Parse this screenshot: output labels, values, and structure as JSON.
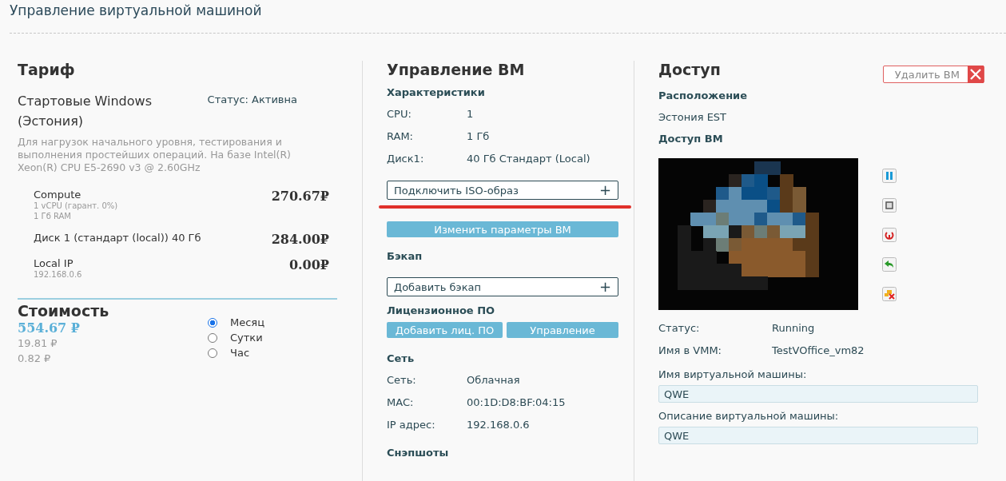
{
  "page_title": "Управление виртуальной машиной",
  "tariff": {
    "heading": "Тариф",
    "name": "Стартовые Windows (Эстония)",
    "status": "Статус: Активна",
    "description": "Для нагрузок начального уровня, тестирования и выполнения простейших операций. На базе Intel(R) Xeon(R) CPU E5-2690 v3 @ 2.60GHz",
    "items": [
      {
        "name": "Compute",
        "details": [
          "1 vCPU (гарант. 0%)",
          "1 Гб RAM"
        ],
        "price": "270.67₽"
      },
      {
        "name": "Диск 1 (стандарт (local)) 40 Гб",
        "price": "284.00₽"
      },
      {
        "name": "Local IP",
        "details": [
          "192.168.0.6"
        ],
        "price": "0.00₽"
      }
    ]
  },
  "cost": {
    "heading": "Стоимость",
    "amounts": [
      "554.67 ₽",
      "19.81 ₽",
      "0.82 ₽"
    ],
    "periods": [
      {
        "label": "Месяц",
        "selected": true
      },
      {
        "label": "Сутки",
        "selected": false
      },
      {
        "label": "Час",
        "selected": false
      }
    ]
  },
  "vm": {
    "heading": "Управление ВМ",
    "specs_heading": "Характеристики",
    "specs": [
      {
        "label": "CPU:",
        "value": "1"
      },
      {
        "label": "RAM:",
        "value": "1 Гб"
      },
      {
        "label": "Диск1:",
        "value": "40 Гб Стандарт (Local)"
      }
    ],
    "iso_button": "Подключить ISO-образ",
    "iso_plus": "+",
    "change_button": "Изменить параметры ВМ",
    "backup_heading": "Бэкап",
    "backup_button": "Добавить бэкап",
    "backup_plus": "+",
    "license_heading": "Лицензионное ПО",
    "license_buttons": [
      "Добавить лиц. ПО",
      "Управление"
    ],
    "network_heading": "Сеть",
    "network": [
      {
        "label": "Сеть:",
        "value": "Облачная"
      },
      {
        "label": "MAC:",
        "value": "00:1D:D8:BF:04:15"
      },
      {
        "label": "IP адрес:",
        "value": "192.168.0.6"
      }
    ],
    "snapshots_heading": "Снэпшоты"
  },
  "access": {
    "heading": "Доступ",
    "delete_button": "Удалить ВМ",
    "location_heading": "Расположение",
    "location": "Эстония EST",
    "vm_access_heading": "Доступ ВМ",
    "actions": [
      {
        "kind": "pause"
      },
      {
        "kind": "stop"
      },
      {
        "kind": "power"
      },
      {
        "kind": "revert"
      },
      {
        "kind": "delete"
      }
    ],
    "info": [
      {
        "label": "Статус:",
        "value": "Running"
      },
      {
        "label": "Имя в VMM:",
        "value": "TestVOffice_vm82"
      }
    ],
    "fields": [
      {
        "label": "Имя виртуальной машины:",
        "value": "QWE"
      },
      {
        "label": "Описание виртуальной машины:",
        "value": "QWE"
      }
    ]
  }
}
